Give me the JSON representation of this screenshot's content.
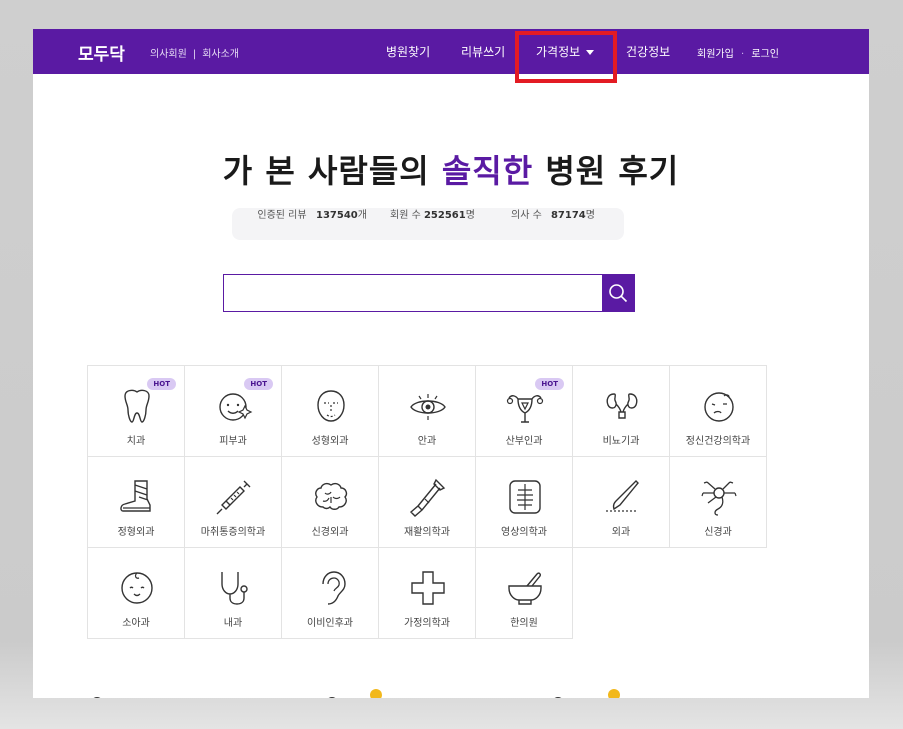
{
  "nav": {
    "logo": "모두닥",
    "doctor_member": "의사회원",
    "separator": "|",
    "about": "회사소개",
    "find_hospital": "병원찾기",
    "write_review": "리뷰쓰기",
    "price_info": "가격정보",
    "health_info": "건강정보",
    "signup": "회원가입",
    "dot": "·",
    "login": "로그인"
  },
  "hero": {
    "title_before": "가 본 사람들의 ",
    "title_accent": "솔직한",
    "title_after": " 병원 후기",
    "accent_color": "#5a1aa3"
  },
  "stats": {
    "reviews_label": "인증된 리뷰",
    "reviews_value": "137540",
    "reviews_unit": "개",
    "members_label": "회원 수",
    "members_value": "252561",
    "members_unit": "명",
    "doctors_label": "의사 수",
    "doctors_value": "87174",
    "doctors_unit": "명"
  },
  "search": {
    "placeholder": "",
    "icon": "search-icon"
  },
  "departments": [
    {
      "label": "치과",
      "hot": "HOT",
      "icon": "tooth-icon"
    },
    {
      "label": "피부과",
      "hot": "HOT",
      "icon": "sparkle-face-icon"
    },
    {
      "label": "성형외과",
      "hot": "",
      "icon": "face-outline-icon"
    },
    {
      "label": "안과",
      "hot": "",
      "icon": "eye-icon"
    },
    {
      "label": "산부인과",
      "hot": "HOT",
      "icon": "uterus-icon"
    },
    {
      "label": "비뇨기과",
      "hot": "",
      "icon": "kidney-icon"
    },
    {
      "label": "정신건강의학과",
      "hot": "",
      "icon": "thinking-face-icon"
    },
    {
      "label": "정형외과",
      "hot": "",
      "icon": "cast-foot-icon"
    },
    {
      "label": "마취통증의학과",
      "hot": "",
      "icon": "syringe-icon"
    },
    {
      "label": "신경외과",
      "hot": "",
      "icon": "brain-icon"
    },
    {
      "label": "재활의학과",
      "hot": "",
      "icon": "crutch-icon"
    },
    {
      "label": "영상의학과",
      "hot": "",
      "icon": "xray-chest-icon"
    },
    {
      "label": "외과",
      "hot": "",
      "icon": "scalpel-icon"
    },
    {
      "label": "신경과",
      "hot": "",
      "icon": "neuron-icon"
    },
    {
      "label": "소아과",
      "hot": "",
      "icon": "baby-face-icon"
    },
    {
      "label": "내과",
      "hot": "",
      "icon": "stethoscope-icon"
    },
    {
      "label": "이비인후과",
      "hot": "",
      "icon": "ear-icon"
    },
    {
      "label": "가정의학과",
      "hot": "",
      "icon": "medical-cross-icon"
    },
    {
      "label": "한의원",
      "hot": "",
      "icon": "mortar-pestle-icon"
    }
  ],
  "colors": {
    "brand": "#5a1aa3",
    "highlight": "#e31b23",
    "hot_bg": "#d9c9f3"
  }
}
